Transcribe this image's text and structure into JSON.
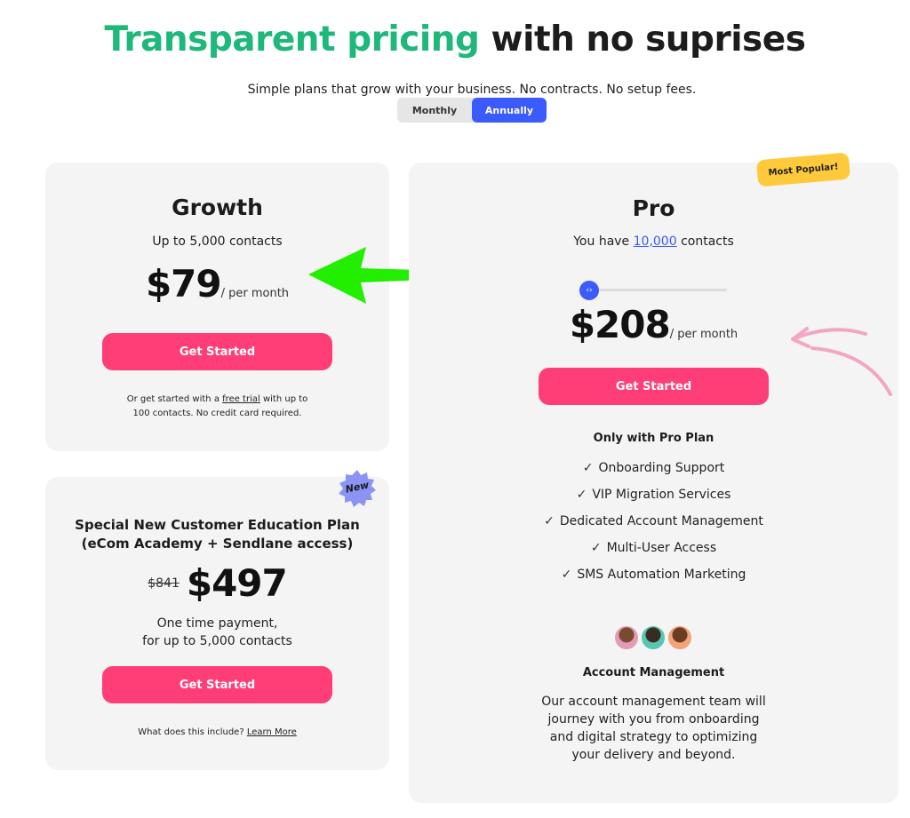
{
  "header": {
    "title_highlight": "Transparent pricing",
    "title_rest": " with no suprises",
    "subtitle": "Simple plans that grow with your business. No contracts. No setup fees."
  },
  "billing_toggle": {
    "monthly": "Monthly",
    "annually": "Annually",
    "selected": "Annually"
  },
  "growth": {
    "name": "Growth",
    "contacts": "Up to 5,000 contacts",
    "price": "$79",
    "period": "/ per month",
    "cta": "Get Started",
    "note_prefix": "Or get started with a",
    "note_link": "free trial",
    "note_suffix": "with up to",
    "note_line2": "100 contacts. No credit card required."
  },
  "edu": {
    "badge": "New",
    "title_line1": "Special New Customer Education Plan",
    "title_line2": "(eCom Academy + Sendlane access)",
    "old_price": "$841",
    "price": "$497",
    "desc_line1": "One time payment,",
    "desc_line2": "for up to 5,000 contacts",
    "cta": "Get Started",
    "footer_q": "What does this include?",
    "footer_link": "Learn More"
  },
  "pro": {
    "badge": "Most Popular!",
    "name": "Pro",
    "contacts_prefix": "You have",
    "contacts_value": "10,000",
    "contacts_suffix": "contacts",
    "slider_value": 0,
    "price": "$208",
    "period": "/ per month",
    "cta": "Get Started",
    "features_title": "Only with Pro Plan",
    "features": [
      "Onboarding Support",
      "VIP Migration Services",
      "Dedicated Account Management",
      "Multi-User Access",
      "SMS Automation Marketing"
    ],
    "account_title": "Account Management",
    "account_lines": [
      "Our account management team will",
      "journey with you from onboarding",
      "and digital strategy to optimizing",
      "your delivery and beyond."
    ]
  },
  "colors": {
    "brand_green": "#1db87a",
    "cta_pink": "#ff3d76",
    "toggle_blue": "#3b5bfd",
    "popular_yellow": "#ffc93c",
    "new_badge": "#8b94f5",
    "arrow_green": "#22ee00",
    "arrow_pink": "#f3a6c4"
  }
}
